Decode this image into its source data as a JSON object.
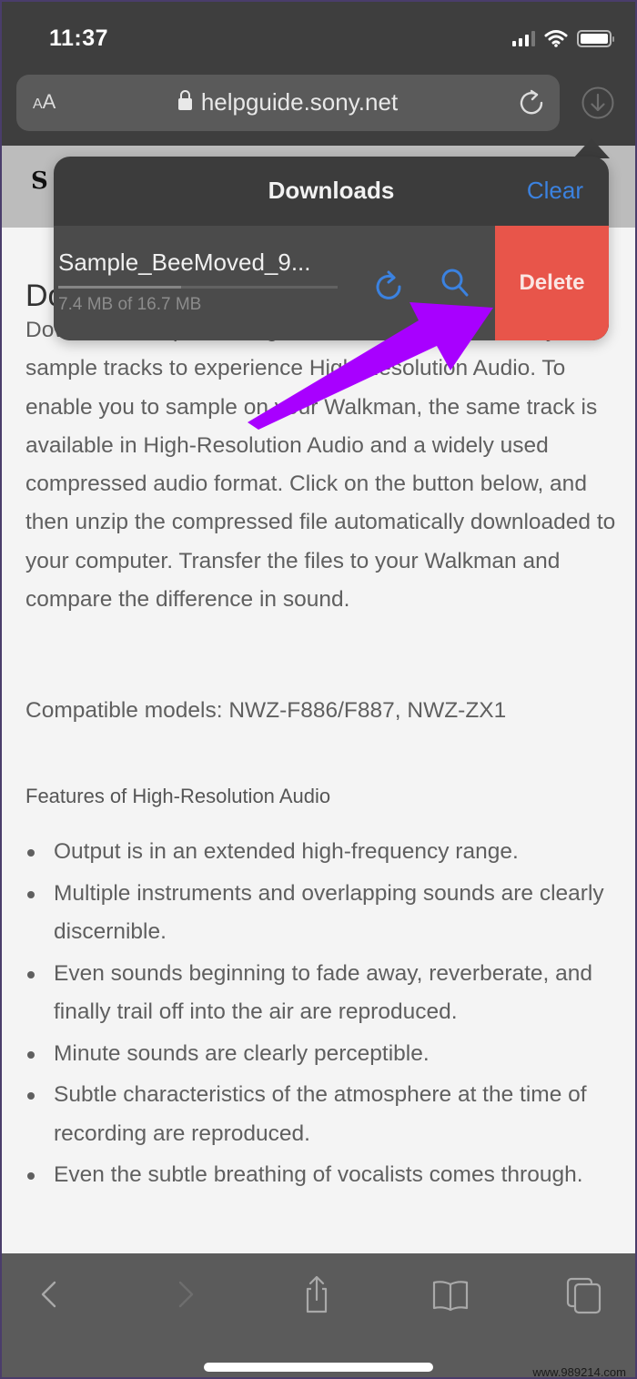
{
  "status_bar": {
    "time": "11:37",
    "signal_icon": "cellular-signal-icon",
    "wifi_icon": "wifi-icon",
    "battery_icon": "battery-icon"
  },
  "browser": {
    "reader_label": "AA",
    "url": "helpguide.sony.net",
    "lock_icon": "lock-icon",
    "reload_icon": "reload-icon",
    "downloads_icon": "download-circle-icon"
  },
  "page": {
    "logo_fragment": "S",
    "heading_fragment": "Do",
    "paragraph": "Download samples of High-Resolution music files. Try out sample tracks to experience High-Resolution Audio. To enable you to sample on your Walkman, the same track is available in High-Resolution Audio and a widely used compressed audio format. Click on the button below, and then unzip the compressed file automatically downloaded to your computer. Transfer the files to your Walkman and compare the difference in sound.",
    "compatible_models": "Compatible models: NWZ-F886/F887, NWZ-ZX1",
    "features_title": "Features of High-Resolution Audio",
    "features": [
      "Output is in an extended high-frequency range.",
      "Multiple instruments and overlapping sounds are clearly discernible.",
      "Even sounds beginning to fade away, reverberate, and finally trail off into the air are reproduced.",
      "Minute sounds are clearly perceptible.",
      "Subtle characteristics of the atmosphere at the time of recording are reproduced.",
      "Even the subtle breathing of vocalists comes through."
    ]
  },
  "downloads_popover": {
    "title": "Downloads",
    "clear_label": "Clear",
    "items": [
      {
        "file_name": "Sample_BeeMoved_9...",
        "size_text": "7.4 MB of 16.7 MB",
        "progress_fraction": 0.44,
        "retry_icon": "retry-icon",
        "reveal_icon": "magnifier-icon",
        "delete_label": "Delete"
      }
    ]
  },
  "toolbar": {
    "back_icon": "chevron-left-icon",
    "forward_icon": "chevron-right-icon",
    "share_icon": "share-icon",
    "bookmarks_icon": "book-icon",
    "tabs_icon": "tabs-icon"
  },
  "annotation": {
    "arrow_color": "#a800ff"
  },
  "colors": {
    "accent_blue": "#3b82e0",
    "delete_red": "#e8554a",
    "popover_bg": "#3c3c3c"
  },
  "watermark": "www.989214.com"
}
